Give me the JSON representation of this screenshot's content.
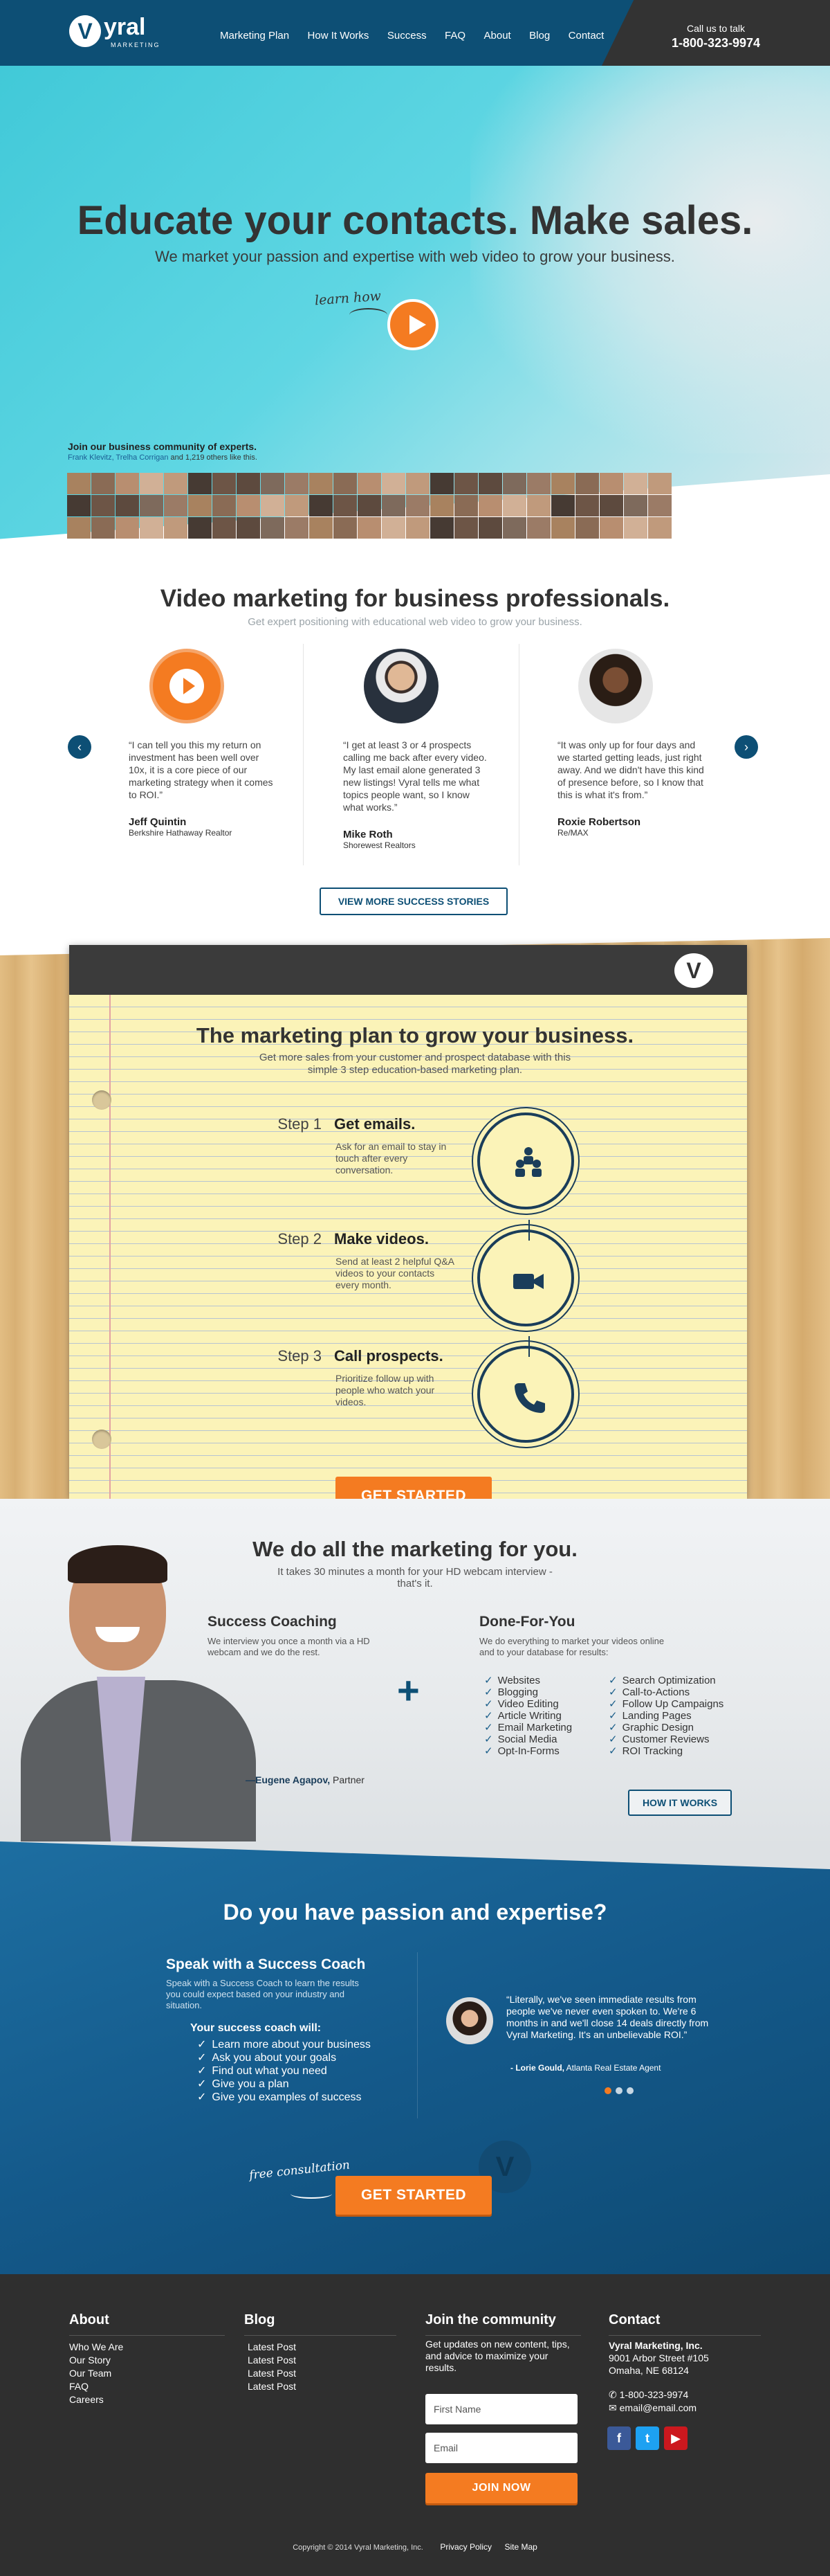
{
  "header": {
    "logo_text": "yral",
    "logo_sub": "MARKETING",
    "logo_letter": "V",
    "nav": [
      "Marketing Plan",
      "How It Works",
      "Success",
      "FAQ",
      "About",
      "Blog",
      "Contact"
    ],
    "call_label": "Call us to talk",
    "phone": "1-800-323-9974"
  },
  "hero": {
    "title": "Educate your contacts. Make sales.",
    "subtitle": "We market your passion and expertise with web video to grow your business.",
    "learn_how": "learn how",
    "community_title": "Join our business community of experts.",
    "community_names": "Frank Klevitz, Trelha Corrigan",
    "community_rest": " and 1,219 others like this."
  },
  "video_marketing": {
    "title": "Video marketing for business professionals.",
    "subtitle": "Get expert positioning with educational web video to grow your business.",
    "testimonials": [
      {
        "quote": "“I can tell you this my return on investment has been well over 10x, it is a core piece of our marketing strategy when it comes to ROI.”",
        "name": "Jeff Quintin",
        "company": "Berkshire Hathaway Realtor"
      },
      {
        "quote": "“I get at least 3 or 4 prospects calling me back after every video. My last email alone generated 3 new listings! Vyral tells me what topics people want, so I know what works.”",
        "name": "Mike Roth",
        "company": "Shorewest Realtors"
      },
      {
        "quote": "“It was only up for four days and we started getting leads, just right away. And we didn't have this kind of presence before, so I know that this is what it's from.”",
        "name": "Roxie Robertson",
        "company": "Re/MAX"
      }
    ],
    "button": "VIEW MORE SUCCESS STORIES"
  },
  "plan": {
    "title": "The marketing plan to grow your business.",
    "subtitle": "Get more sales from your customer and prospect database with this simple 3 step education-based marketing plan.",
    "steps": [
      {
        "num": "Step 1",
        "title": "Get emails.",
        "desc": "Ask for an email to stay in touch after every conversation.",
        "icon": "people-icon"
      },
      {
        "num": "Step 2",
        "title": "Make videos.",
        "desc": "Send at least 2 helpful Q&A videos to your contacts every month.",
        "icon": "video-camera-icon"
      },
      {
        "num": "Step 3",
        "title": "Call prospects.",
        "desc": "Prioritize follow up with people who watch your videos.",
        "icon": "phone-icon"
      }
    ],
    "button": "GET STARTED"
  },
  "marketing": {
    "title": "We do all the marketing for you.",
    "subtitle": "It takes 30 minutes a month for your HD webcam interview - that's it.",
    "coaching_title": "Success Coaching",
    "coaching_desc": "We interview you once a month via a HD webcam and we do the rest.",
    "dfy_title": "Done-For-You",
    "dfy_desc": "We do everything to market your videos online and to your database for results:",
    "list_left": [
      "Websites",
      "Blogging",
      "Video Editing",
      "Article Writing",
      "Email Marketing",
      "Social Media",
      "Opt-In-Forms"
    ],
    "list_right": [
      "Search Optimization",
      "Call-to-Actions",
      "Follow Up Campaigns",
      "Landing Pages",
      "Graphic Design",
      "Customer Reviews",
      "ROI Tracking"
    ],
    "partner_name": "—Eugene Agapov,",
    "partner_role": " Partner",
    "button": "HOW IT WORKS"
  },
  "passion": {
    "title": "Do you have passion and expertise?",
    "coach_title": "Speak with a Success Coach",
    "coach_desc": "Speak with a Success Coach to learn the results you could expect based on your industry and situation.",
    "will_title": "Your success coach will:",
    "will_list": [
      "Learn more about your business",
      "Ask you about your goals",
      "Find out what you need",
      "Give you a plan",
      "Give you examples of success"
    ],
    "quote": "“Literally, we've seen immediate results from people we've never even spoken to. We're 6 months in and we'll close 14 deals directly from Vyral Marketing. It's an unbelievable ROI.”",
    "quote_name": "- Lorie Gould,",
    "quote_company": " Atlanta Real Estate Agent",
    "free_label": "free consultation",
    "button": "GET STARTED"
  },
  "footer": {
    "about_title": "About",
    "about_links": [
      "Who We Are",
      "Our Story",
      "Our Team",
      "FAQ",
      "Careers"
    ],
    "blog_title": "Blog",
    "blog_links": [
      "Latest Post",
      "Latest Post",
      "Latest Post",
      "Latest Post"
    ],
    "community_title": "Join the community",
    "community_desc": "Get updates on new content, tips, and advice to maximize your results.",
    "first_name_placeholder": "First Name",
    "email_placeholder": "Email",
    "join_button": "JOIN NOW",
    "contact_title": "Contact",
    "company": "Vyral Marketing, Inc.",
    "address1": "9001 Arbor Street #105",
    "address2": "Omaha, NE 68124",
    "phone": "1-800-323-9974",
    "email": "email@email.com",
    "copyright": "Copyright © 2014 Vyral Marketing, Inc.",
    "privacy": "Privacy Policy",
    "sitemap": "Site Map"
  },
  "colors": {
    "primary": "#0d4f75",
    "accent": "#f47b21",
    "hero": "#41c9d8",
    "footer": "#2f2f2f"
  }
}
